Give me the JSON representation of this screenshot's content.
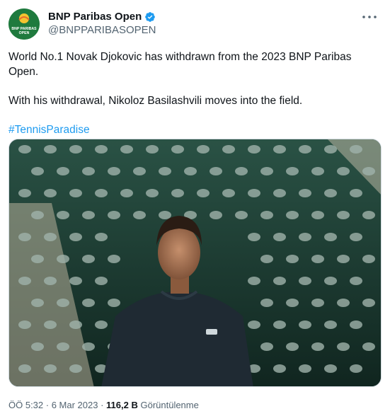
{
  "account": {
    "display_name": "BNP Paribas Open",
    "handle": "@BNPPARIBASOPEN",
    "avatar_lines": [
      "BNP PARIBAS",
      "OPEN"
    ]
  },
  "tweet": {
    "paragraph_1": "World No.1 Novak Djokovic has withdrawn from the 2023 BNP Paribas Open.",
    "paragraph_2": "With his withdrawal, Nikoloz Basilashvili moves into the field.",
    "hashtag": "#TennisParadise"
  },
  "footer": {
    "time": "ÖÖ 5:32",
    "separator_1": " · ",
    "date": "6 Mar 2023",
    "separator_2": " · ",
    "views_count": "116,2 B",
    "views_label": " Görüntülenme"
  },
  "colors": {
    "link": "#1d9bf0",
    "verified": "#1d9bf0",
    "brand_green": "#1f7a3e"
  },
  "icons": {
    "more": "more-dots-icon",
    "verified": "verified-badge-icon"
  }
}
